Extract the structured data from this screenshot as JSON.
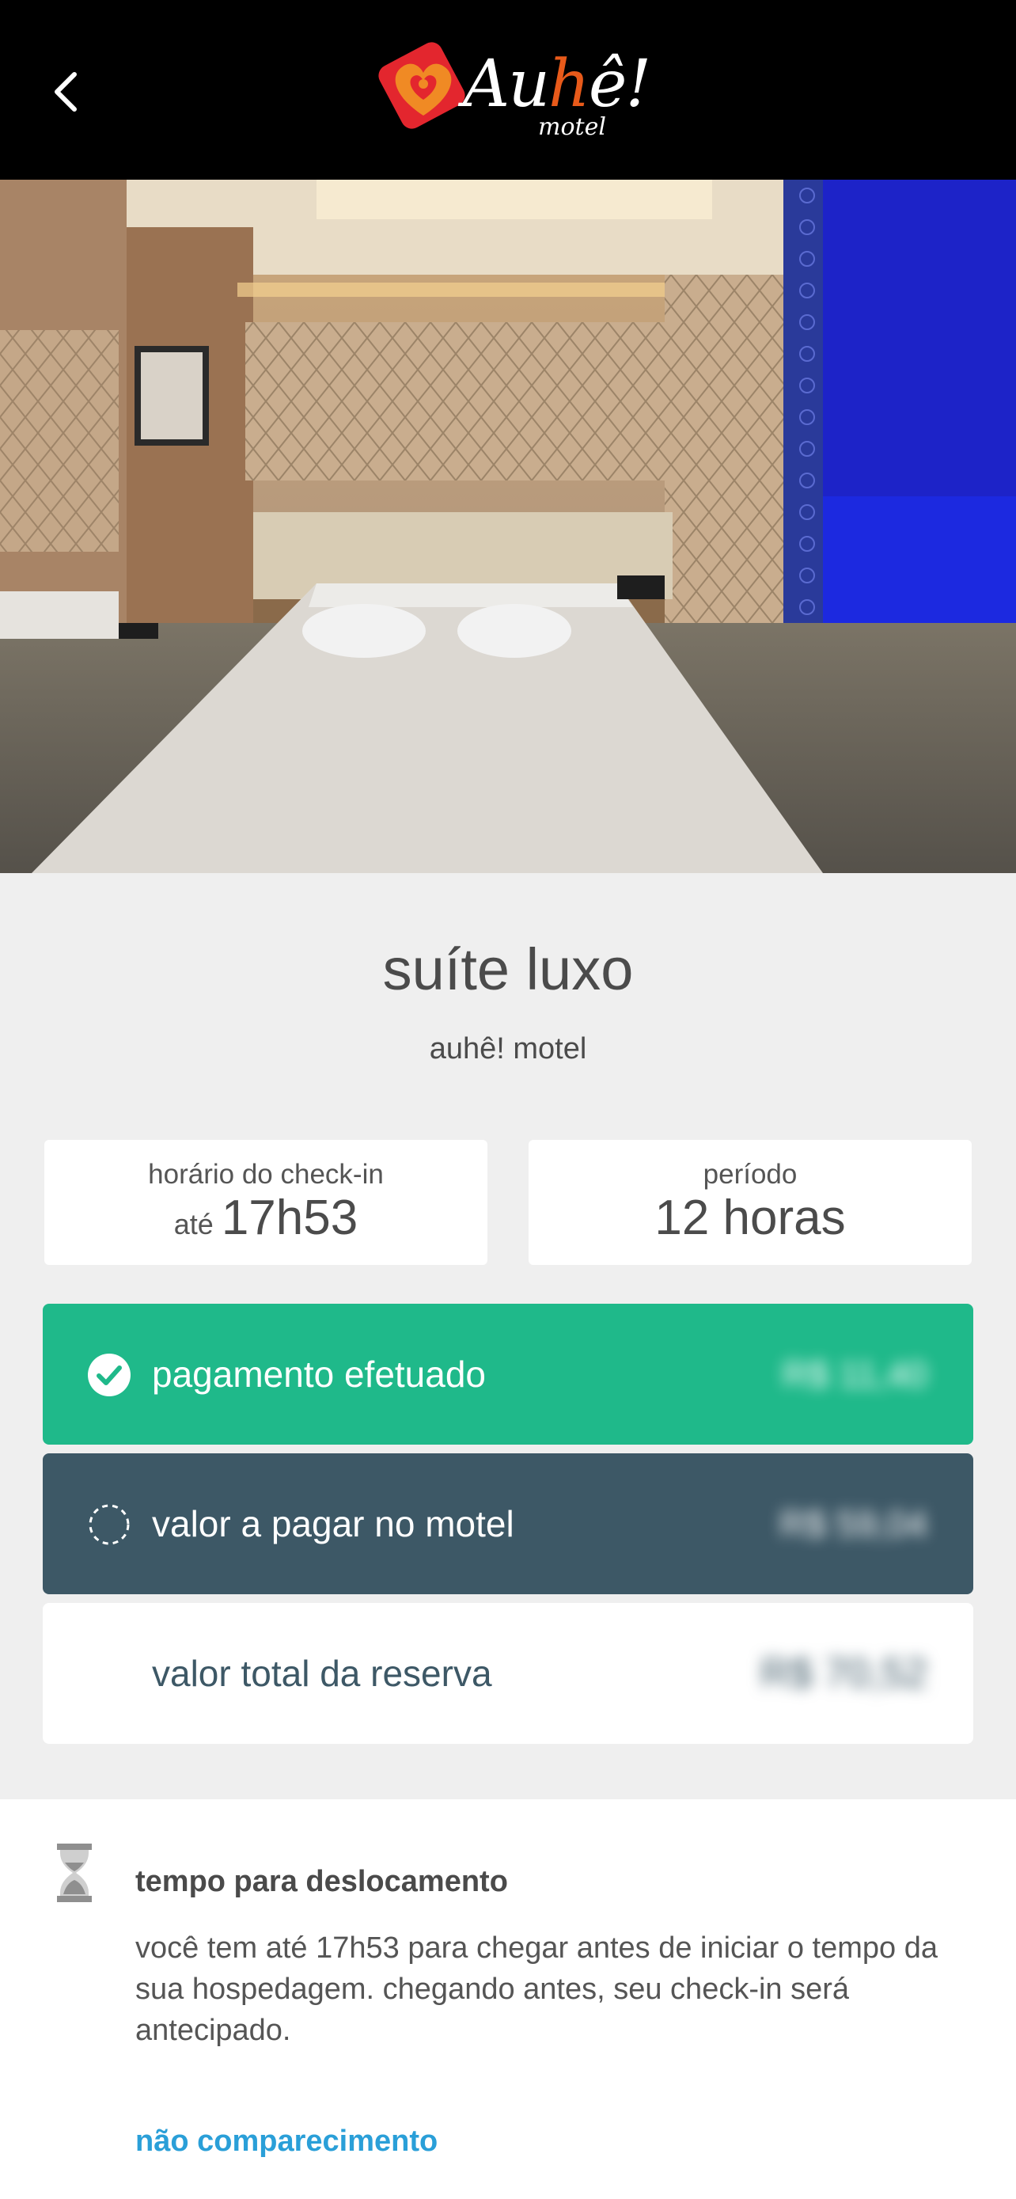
{
  "header": {
    "back_icon": "chevron-left-icon",
    "logo_text_a": "Au",
    "logo_text_accent": "h",
    "logo_text_b": "ê!",
    "logo_sub": "motel"
  },
  "suite": {
    "name": "suíte luxo",
    "motel": "auhê! motel"
  },
  "checkin": {
    "label": "horário do check-in",
    "prefix": "até",
    "time": "17h53"
  },
  "period": {
    "label": "período",
    "value": "12 horas"
  },
  "payments": {
    "paid_label": "pagamento efetuado",
    "paid_amount": "R$ 11,40",
    "due_label": "valor a pagar no motel",
    "due_amount": "R$ 59,04",
    "total_label": "valor total da reserva",
    "total_amount": "R$ 70,52"
  },
  "travel": {
    "heading": "tempo para deslocamento",
    "body": "você tem até 17h53 para chegar antes de iniciar o tempo da sua hospedagem. chegando antes, seu check-in será antecipado.",
    "link": "não comparecimento"
  },
  "colors": {
    "paid": "#1fb98a",
    "due": "#3d5866",
    "link": "#2a9fd8",
    "logo_red": "#e3262e",
    "logo_orange": "#e85a1a"
  }
}
